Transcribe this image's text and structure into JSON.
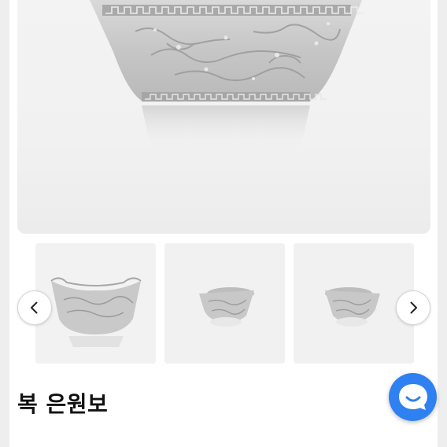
{
  "product": {
    "title": "복 은원보"
  },
  "gallery": {
    "main_image": "silver-ingot-bowl-dragon-relief",
    "thumbnails": [
      {
        "name": "thumbnail-front-view"
      },
      {
        "name": "thumbnail-side-view"
      },
      {
        "name": "thumbnail-side-view-2"
      }
    ],
    "prev_icon": "chevron-left-icon",
    "next_icon": "chevron-right-icon"
  },
  "chat": {
    "icon": "chat-bubble-smile-icon",
    "color": "#2f80f0"
  },
  "colors": {
    "page_bg": "#eeeeee",
    "card_bg": "#ffffff",
    "title_text": "#111111"
  }
}
